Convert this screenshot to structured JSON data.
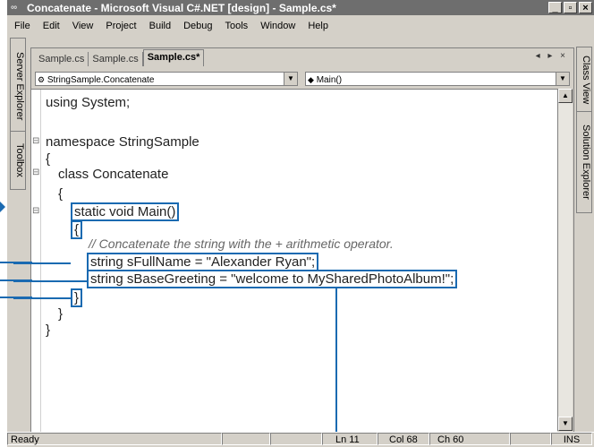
{
  "window": {
    "title": "Concatenate - Microsoft Visual C#.NET [design] - Sample.cs*",
    "app_icon": "vs-icon"
  },
  "caption_buttons": {
    "minimize": "_",
    "maximize": "\b",
    "close": "×"
  },
  "menu": [
    "File",
    "Edit",
    "View",
    "Project",
    "Build",
    "Debug",
    "Tools",
    "Window",
    "Help"
  ],
  "left_tabs": [
    "Server Explorer",
    "Toolbox"
  ],
  "right_tabs": [
    "Class View",
    "Solution Explorer"
  ],
  "doc_tabs": [
    "Sample.cs",
    "Sample.cs",
    "Sample.cs*"
  ],
  "tab_nav": "◂ ▸ ×",
  "combos": {
    "type": "StringSample.Concatenate",
    "member": "Main()"
  },
  "code": {
    "line1": "using System;",
    "line2": "namespace StringSample",
    "line3": "{",
    "line4": "class Concatenate",
    "line5": "{",
    "line6": "static void Main()",
    "line7": "{",
    "line8": "// Concatenate the string with the + arithmetic operator.",
    "line9": "string sFullName = \"Alexander Ryan\";",
    "line10": "string sBaseGreeting = \"welcome to MySharedPhotoAlbum!\";",
    "line11": "}",
    "line12": "}",
    "line13": "}"
  },
  "status": {
    "ready": "Ready",
    "ln": "Ln 11",
    "col": "Col 68",
    "ch": "Ch 60",
    "ins": "INS"
  },
  "colors": {
    "accent": "#1a6ab1",
    "titlebar": "#6e6e6e",
    "chrome": "#d4d0c8"
  }
}
